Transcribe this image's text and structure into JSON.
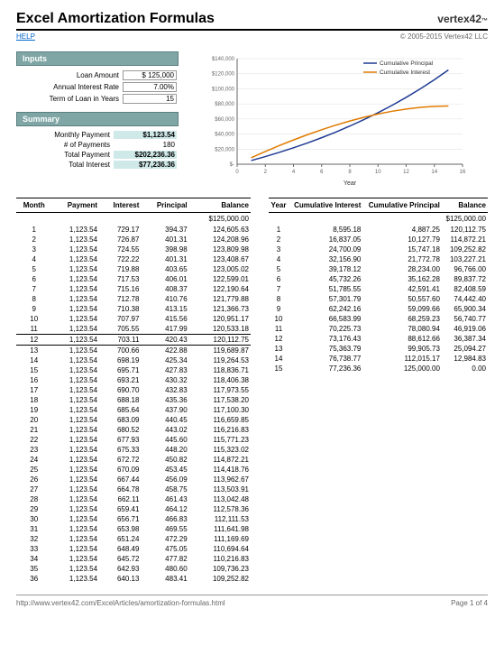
{
  "header": {
    "title": "Excel Amortization Formulas",
    "logo": "vertex42",
    "help": "HELP",
    "copyright": "© 2005-2015 Vertex42 LLC"
  },
  "inputs": {
    "header": "Inputs",
    "loan_amount_label": "Loan Amount",
    "loan_amount": "$   125,000",
    "rate_label": "Annual Interest Rate",
    "rate": "7.00%",
    "term_label": "Term of Loan in Years",
    "term": "15"
  },
  "summary": {
    "header": "Summary",
    "monthly_payment_label": "Monthly Payment",
    "monthly_payment": "$1,123.54",
    "num_payments_label": "# of Payments",
    "num_payments": "180",
    "total_payment_label": "Total Payment",
    "total_payment": "$202,236.36",
    "total_interest_label": "Total Interest",
    "total_interest": "$77,236.36"
  },
  "chart_data": {
    "type": "line",
    "xlabel": "Year",
    "ylabel": "",
    "xlim": [
      0,
      16
    ],
    "ylim": [
      0,
      140000
    ],
    "xticks": [
      0,
      2,
      4,
      6,
      8,
      10,
      12,
      14,
      16
    ],
    "yticks": [
      0,
      20000,
      40000,
      60000,
      80000,
      100000,
      120000,
      140000
    ],
    "ytick_labels": [
      "$-",
      "$20,000",
      "$40,000",
      "$60,000",
      "$80,000",
      "$100,000",
      "$120,000",
      "$140,000"
    ],
    "series": [
      {
        "name": "Cumulative Principal",
        "color": "#1f3a93",
        "x": [
          1,
          2,
          3,
          4,
          5,
          6,
          7,
          8,
          9,
          10,
          11,
          12,
          13,
          14,
          15
        ],
        "y": [
          4887.25,
          10127.79,
          15747.18,
          21772.78,
          28234.0,
          35162.28,
          42591.41,
          50557.6,
          59099.66,
          68259.23,
          78080.94,
          88612.66,
          99905.73,
          112015.17,
          125000.0
        ]
      },
      {
        "name": "Cumulative Interest",
        "color": "#e07b00",
        "x": [
          1,
          2,
          3,
          4,
          5,
          6,
          7,
          8,
          9,
          10,
          11,
          12,
          13,
          14,
          15
        ],
        "y": [
          8595.18,
          16837.05,
          24700.09,
          32156.9,
          39178.12,
          45732.26,
          51785.55,
          57301.79,
          62242.16,
          66583.99,
          70225.73,
          73176.43,
          75363.79,
          76738.77,
          77236.36
        ]
      }
    ],
    "legend_position": "top-right"
  },
  "monthly_table": {
    "headers": [
      "Month",
      "Payment",
      "Interest",
      "Principal",
      "Balance"
    ],
    "start_balance": "$125,000.00",
    "rows": [
      {
        "m": 1,
        "p": "1,123.54",
        "i": "729.17",
        "pr": "394.37",
        "b": "124,605.63"
      },
      {
        "m": 2,
        "p": "1,123.54",
        "i": "726.87",
        "pr": "401.31",
        "b": "124,208.96"
      },
      {
        "m": 3,
        "p": "1,123.54",
        "i": "724.55",
        "pr": "398.98",
        "b": "123,809.98"
      },
      {
        "m": 4,
        "p": "1,123.54",
        "i": "722.22",
        "pr": "401.31",
        "b": "123,408.67"
      },
      {
        "m": 5,
        "p": "1,123.54",
        "i": "719.88",
        "pr": "403.65",
        "b": "123,005.02"
      },
      {
        "m": 6,
        "p": "1,123.54",
        "i": "717.53",
        "pr": "406.01",
        "b": "122,599.01"
      },
      {
        "m": 7,
        "p": "1,123.54",
        "i": "715.16",
        "pr": "408.37",
        "b": "122,190.64"
      },
      {
        "m": 8,
        "p": "1,123.54",
        "i": "712.78",
        "pr": "410.76",
        "b": "121,779.88"
      },
      {
        "m": 9,
        "p": "1,123.54",
        "i": "710.38",
        "pr": "413.15",
        "b": "121,366.73"
      },
      {
        "m": 10,
        "p": "1,123.54",
        "i": "707.97",
        "pr": "415.56",
        "b": "120,951.17"
      },
      {
        "m": 11,
        "p": "1,123.54",
        "i": "705.55",
        "pr": "417.99",
        "b": "120,533.18"
      },
      {
        "m": 12,
        "p": "1,123.54",
        "i": "703.11",
        "pr": "420.43",
        "b": "120,112.75"
      },
      {
        "m": 13,
        "p": "1,123.54",
        "i": "700.66",
        "pr": "422.88",
        "b": "119,689.87"
      },
      {
        "m": 14,
        "p": "1,123.54",
        "i": "698.19",
        "pr": "425.34",
        "b": "119,264.53"
      },
      {
        "m": 15,
        "p": "1,123.54",
        "i": "695.71",
        "pr": "427.83",
        "b": "118,836.71"
      },
      {
        "m": 16,
        "p": "1,123.54",
        "i": "693.21",
        "pr": "430.32",
        "b": "118,406.38"
      },
      {
        "m": 17,
        "p": "1,123.54",
        "i": "690.70",
        "pr": "432.83",
        "b": "117,973.55"
      },
      {
        "m": 18,
        "p": "1,123.54",
        "i": "688.18",
        "pr": "435.36",
        "b": "117,538.20"
      },
      {
        "m": 19,
        "p": "1,123.54",
        "i": "685.64",
        "pr": "437.90",
        "b": "117,100.30"
      },
      {
        "m": 20,
        "p": "1,123.54",
        "i": "683.09",
        "pr": "440.45",
        "b": "116,659.85"
      },
      {
        "m": 21,
        "p": "1,123.54",
        "i": "680.52",
        "pr": "443.02",
        "b": "116,216.83"
      },
      {
        "m": 22,
        "p": "1,123.54",
        "i": "677.93",
        "pr": "445.60",
        "b": "115,771.23"
      },
      {
        "m": 23,
        "p": "1,123.54",
        "i": "675.33",
        "pr": "448.20",
        "b": "115,323.02"
      },
      {
        "m": 24,
        "p": "1,123.54",
        "i": "672.72",
        "pr": "450.82",
        "b": "114,872.21"
      },
      {
        "m": 25,
        "p": "1,123.54",
        "i": "670.09",
        "pr": "453.45",
        "b": "114,418.76"
      },
      {
        "m": 26,
        "p": "1,123.54",
        "i": "667.44",
        "pr": "456.09",
        "b": "113,962.67"
      },
      {
        "m": 27,
        "p": "1,123.54",
        "i": "664.78",
        "pr": "458.75",
        "b": "113,503.91"
      },
      {
        "m": 28,
        "p": "1,123.54",
        "i": "662.11",
        "pr": "461.43",
        "b": "113,042.48"
      },
      {
        "m": 29,
        "p": "1,123.54",
        "i": "659.41",
        "pr": "464.12",
        "b": "112,578.36"
      },
      {
        "m": 30,
        "p": "1,123.54",
        "i": "656.71",
        "pr": "466.83",
        "b": "112,111.53"
      },
      {
        "m": 31,
        "p": "1,123.54",
        "i": "653.98",
        "pr": "469.55",
        "b": "111,641.98"
      },
      {
        "m": 32,
        "p": "1,123.54",
        "i": "651.24",
        "pr": "472.29",
        "b": "111,169.69"
      },
      {
        "m": 33,
        "p": "1,123.54",
        "i": "648.49",
        "pr": "475.05",
        "b": "110,694.64"
      },
      {
        "m": 34,
        "p": "1,123.54",
        "i": "645.72",
        "pr": "477.82",
        "b": "110,216.83"
      },
      {
        "m": 35,
        "p": "1,123.54",
        "i": "642.93",
        "pr": "480.60",
        "b": "109,736.23"
      },
      {
        "m": 36,
        "p": "1,123.54",
        "i": "640.13",
        "pr": "483.41",
        "b": "109,252.82"
      }
    ]
  },
  "yearly_table": {
    "headers": [
      "Year",
      "Cumulative Interest",
      "Cumulative Principal",
      "Balance"
    ],
    "start_balance": "$125,000.00",
    "rows": [
      {
        "y": 1,
        "ci": "8,595.18",
        "cp": "4,887.25",
        "b": "120,112.75"
      },
      {
        "y": 2,
        "ci": "16,837.05",
        "cp": "10,127.79",
        "b": "114,872.21"
      },
      {
        "y": 3,
        "ci": "24,700.09",
        "cp": "15,747.18",
        "b": "109,252.82"
      },
      {
        "y": 4,
        "ci": "32,156.90",
        "cp": "21,772.78",
        "b": "103,227.21"
      },
      {
        "y": 5,
        "ci": "39,178.12",
        "cp": "28,234.00",
        "b": "96,766.00"
      },
      {
        "y": 6,
        "ci": "45,732.26",
        "cp": "35,162.28",
        "b": "89,837.72"
      },
      {
        "y": 7,
        "ci": "51,785.55",
        "cp": "42,591.41",
        "b": "82,408.59"
      },
      {
        "y": 8,
        "ci": "57,301.79",
        "cp": "50,557.60",
        "b": "74,442.40"
      },
      {
        "y": 9,
        "ci": "62,242.16",
        "cp": "59,099.66",
        "b": "65,900.34"
      },
      {
        "y": 10,
        "ci": "66,583.99",
        "cp": "68,259.23",
        "b": "56,740.77"
      },
      {
        "y": 11,
        "ci": "70,225.73",
        "cp": "78,080.94",
        "b": "46,919.06"
      },
      {
        "y": 12,
        "ci": "73,176.43",
        "cp": "88,612.66",
        "b": "36,387.34"
      },
      {
        "y": 13,
        "ci": "75,363.79",
        "cp": "99,905.73",
        "b": "25,094.27"
      },
      {
        "y": 14,
        "ci": "76,738.77",
        "cp": "112,015.17",
        "b": "12,984.83"
      },
      {
        "y": 15,
        "ci": "77,236.36",
        "cp": "125,000.00",
        "b": "0.00"
      }
    ]
  },
  "footer": {
    "url": "http://www.vertex42.com/ExcelArticles/amortization-formulas.html",
    "page": "Page 1 of 4"
  }
}
